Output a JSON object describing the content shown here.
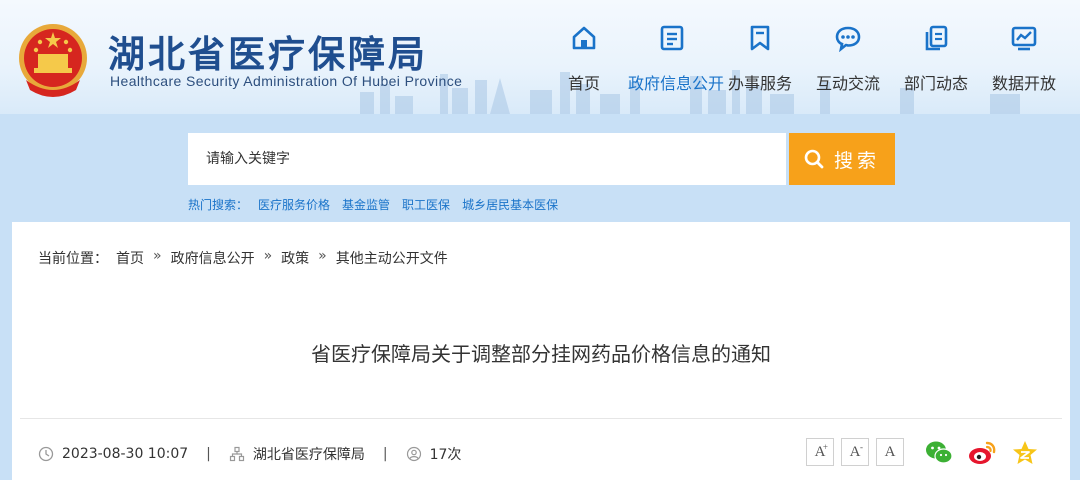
{
  "header": {
    "title": "湖北省医疗保障局",
    "subtitle": "Healthcare Security Administration Of Hubei Province",
    "emblem_icon": "national-emblem-icon"
  },
  "nav": {
    "items": [
      {
        "label": "首页",
        "icon": "home-icon",
        "active": false
      },
      {
        "label": "政府信息公开",
        "icon": "document-list-icon",
        "active": true
      },
      {
        "label": "办事服务",
        "icon": "bookmark-icon",
        "active": false
      },
      {
        "label": "互动交流",
        "icon": "chat-bubble-icon",
        "active": false
      },
      {
        "label": "部门动态",
        "icon": "copy-documents-icon",
        "active": false
      },
      {
        "label": "数据开放",
        "icon": "chart-board-icon",
        "active": false
      }
    ]
  },
  "search": {
    "placeholder": "请输入关键字",
    "button_label": "搜索",
    "hot_label": "热门搜索：",
    "hot_links": [
      "医疗服务价格",
      "基金监管",
      "职工医保",
      "城乡居民基本医保"
    ]
  },
  "breadcrumb": {
    "label": "当前位置：",
    "items": [
      "首页",
      "政府信息公开",
      "政策",
      "其他主动公开文件"
    ],
    "separator": "»"
  },
  "article": {
    "title": "省医疗保障局关于调整部分挂网药品价格信息的通知",
    "date": "2023-08-30 10:07",
    "source": "湖北省医疗保障局",
    "views": "17次",
    "separator": "|"
  },
  "font_tools": {
    "increase": "A",
    "increase_mark": "+",
    "decrease": "A",
    "decrease_mark": "-",
    "default": "A"
  },
  "share": [
    "wechat-icon",
    "weibo-icon",
    "qzone-icon"
  ],
  "colors": {
    "brand_blue": "#1f4e8f",
    "link_blue": "#1a73c9",
    "search_orange": "#f7a11a",
    "band_blue": "#c8e0f6"
  }
}
